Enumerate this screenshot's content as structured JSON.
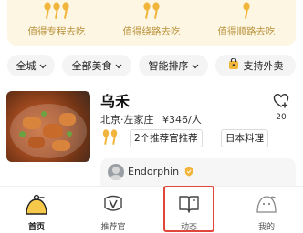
{
  "recommend": [
    {
      "label": "值得专程去吃"
    },
    {
      "label": "值得绕路去吃"
    },
    {
      "label": "值得顺路去吃"
    }
  ],
  "filters": {
    "city": "全城",
    "category": "全部美食",
    "sort": "智能排序",
    "delivery": "支持外卖"
  },
  "restaurant": {
    "name": "乌禾",
    "location": "北京·左家庄",
    "price": "¥346/人",
    "favorite_count": "20",
    "recommenders": "2个推荐官推荐",
    "cuisine": "日本料理"
  },
  "review": {
    "author": "Endorphin"
  },
  "nav": {
    "home": "首页",
    "recommender": "推荐官",
    "feed": "动态",
    "mine": "我的"
  },
  "colors": {
    "accent_gold": "#f2b53c",
    "rec_text": "#b9913a",
    "highlight": "#e0463a"
  }
}
